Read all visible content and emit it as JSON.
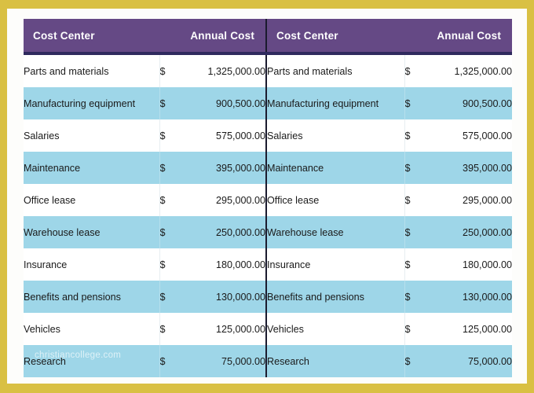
{
  "theme": {
    "frame_color": "#d9c043",
    "header_bg": "#654985",
    "header_rule": "#2f2a5e",
    "header_text": "#ffffff",
    "row_alt_bg": "#9ed6e8",
    "row_bg": "#ffffff",
    "body_text": "#1a1a1a",
    "table_divider": "#1b1b2e"
  },
  "watermark": {
    "text": "christiancollege.com"
  },
  "table": {
    "headers": {
      "cost_center": "Cost Center",
      "annual_cost": "Annual Cost"
    },
    "currency_symbol": "$",
    "rows": [
      {
        "cost_center": "Parts and materials",
        "amount": "1,325,000.00"
      },
      {
        "cost_center": "Manufacturing equipment",
        "amount": "900,500.00"
      },
      {
        "cost_center": "Salaries",
        "amount": "575,000.00"
      },
      {
        "cost_center": "Maintenance",
        "amount": "395,000.00"
      },
      {
        "cost_center": "Office lease",
        "amount": "295,000.00"
      },
      {
        "cost_center": "Warehouse lease",
        "amount": "250,000.00"
      },
      {
        "cost_center": "Insurance",
        "amount": "180,000.00"
      },
      {
        "cost_center": "Benefits and pensions",
        "amount": "130,000.00"
      },
      {
        "cost_center": "Vehicles",
        "amount": "125,000.00"
      },
      {
        "cost_center": "Research",
        "amount": "75,000.00"
      }
    ]
  }
}
